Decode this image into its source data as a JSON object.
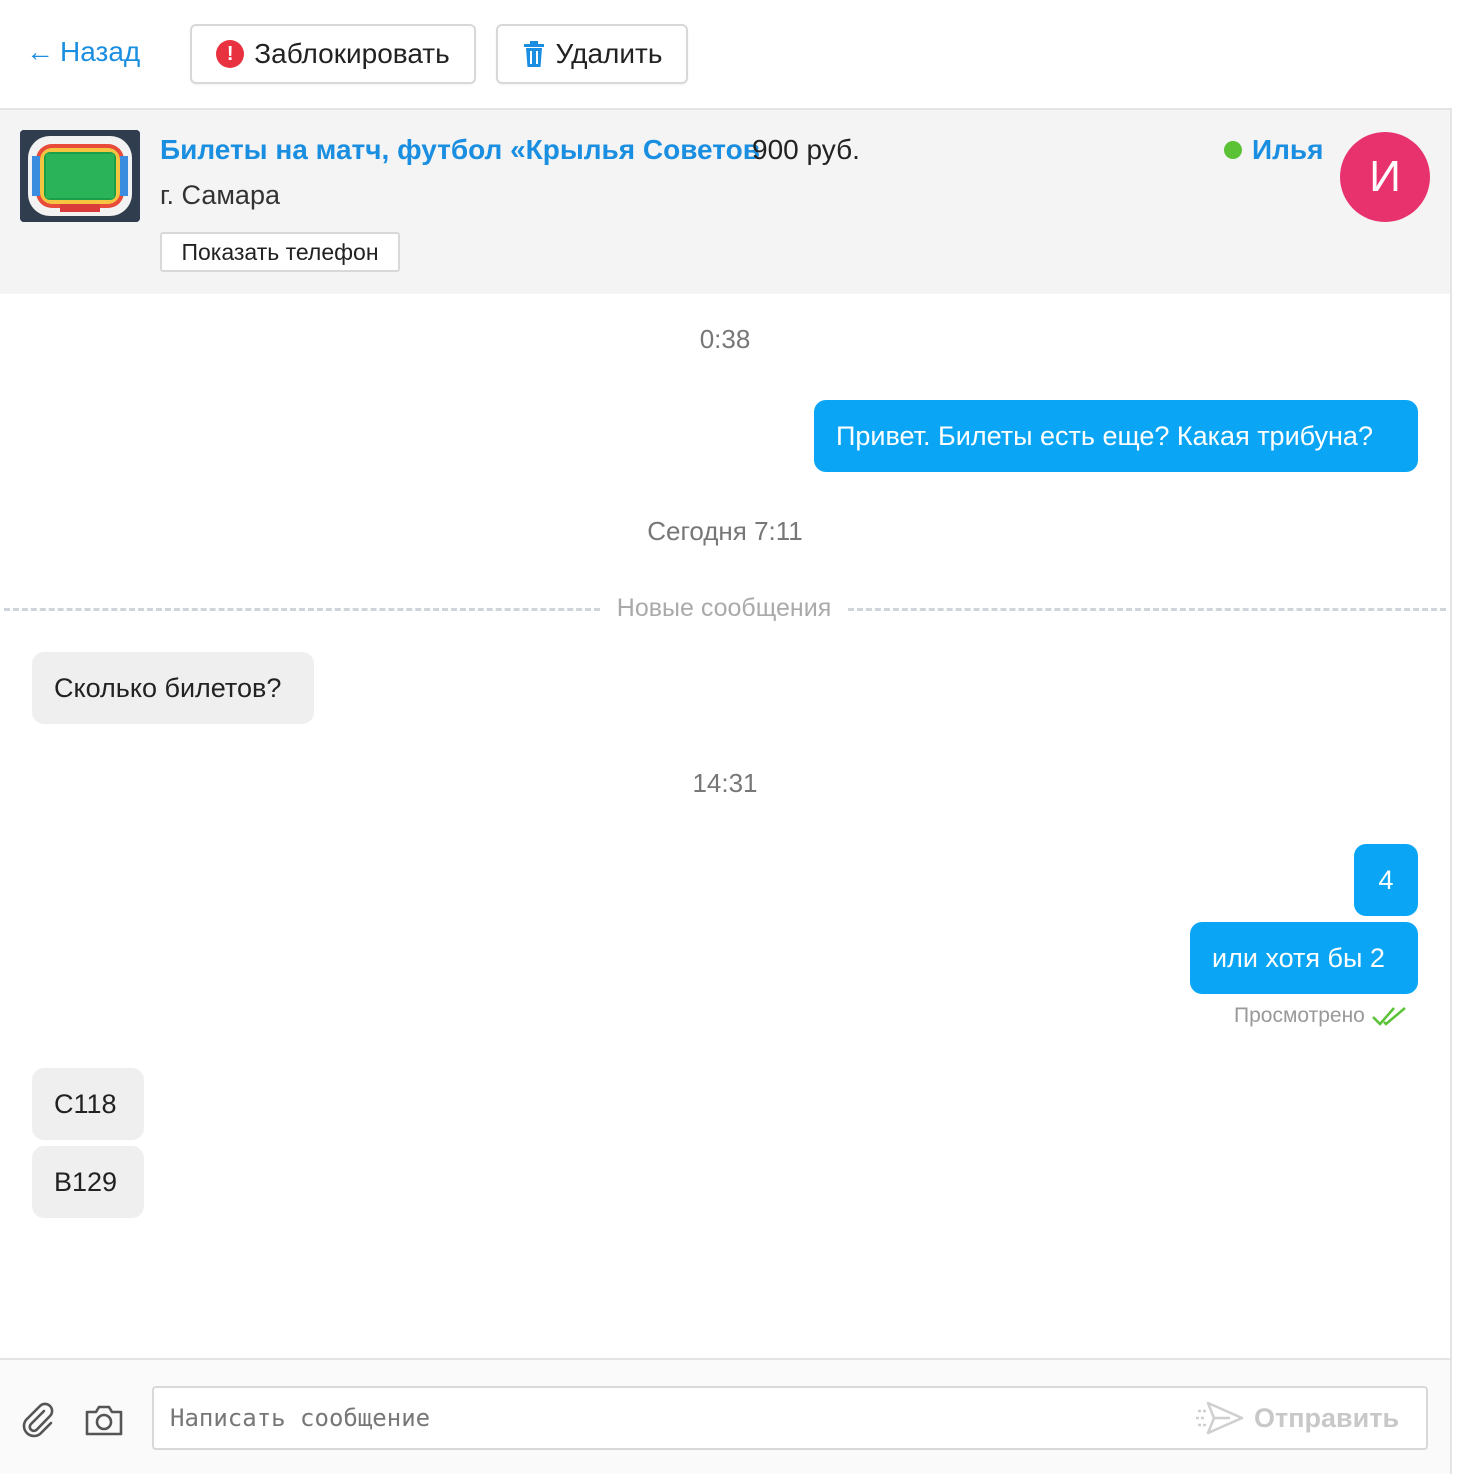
{
  "toolbar": {
    "back_label": "Назад",
    "block_label": "Заблокировать",
    "delete_label": "Удалить"
  },
  "listing": {
    "title": "Билеты на матч, футбол «Крылья Советов",
    "price": "900 руб.",
    "city": "г. Самара",
    "show_phone_label": "Показать телефон"
  },
  "user": {
    "name": "Илья",
    "avatar_letter": "И",
    "status": "online"
  },
  "messages": {
    "time_1": "0:38",
    "msg_1": "Привет. Билеты есть еще? Какая трибуна?",
    "time_2": "Сегодня 7:11",
    "new_messages_label": "Новые сообщения",
    "msg_2": "Сколько билетов?",
    "time_3": "14:31",
    "msg_3": "4",
    "msg_4": "или хотя бы 2",
    "seen_label": "Просмотрено",
    "msg_5": "С118",
    "msg_6": "В129"
  },
  "composer": {
    "placeholder": "Написать сообщение",
    "send_label": "Отправить"
  },
  "colors": {
    "accent": "#1a8ee0",
    "outgoing_bubble": "#0aa6f5",
    "incoming_bubble": "#efefef",
    "avatar": "#e8326e",
    "online": "#5bc236",
    "danger": "#e8323f"
  },
  "icons": [
    "back-arrow-icon",
    "alert-icon",
    "trash-icon",
    "online-dot-icon",
    "double-check-icon",
    "paperclip-icon",
    "camera-icon",
    "send-icon"
  ]
}
